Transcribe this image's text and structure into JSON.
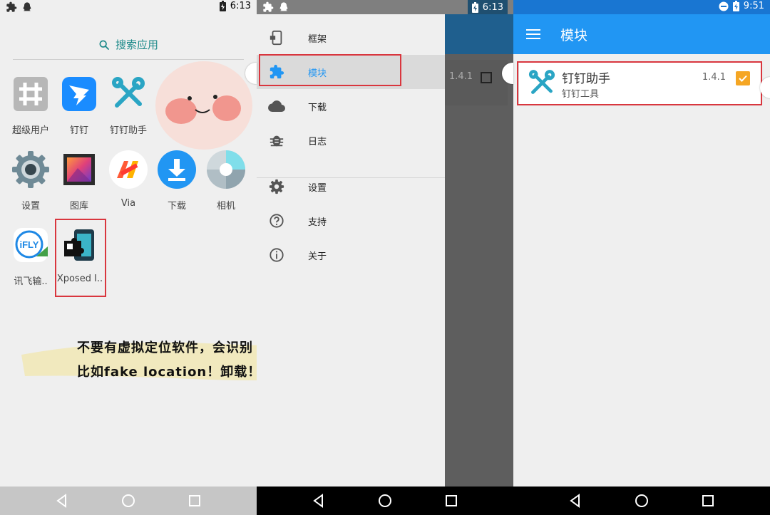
{
  "panel1": {
    "status_time": "6:13",
    "search_label": "搜索应用",
    "apps": [
      {
        "label": "超级用户",
        "icon": "superuser-icon"
      },
      {
        "label": "钉钉",
        "icon": "dingtalk-icon"
      },
      {
        "label": "钉钉助手",
        "icon": "tools-icon"
      },
      {
        "label": "设置",
        "icon": "settings-icon"
      },
      {
        "label": "图库",
        "icon": "gallery-icon"
      },
      {
        "label": "Via",
        "icon": "via-icon"
      },
      {
        "label": "下载",
        "icon": "download-icon"
      },
      {
        "label": "相机",
        "icon": "camera-icon"
      },
      {
        "label": "讯飞输..",
        "icon": "ifly-icon"
      },
      {
        "label": "Xposed I..",
        "icon": "xposed-icon"
      }
    ],
    "note_line1": "不要有虚拟定位软件，会识别",
    "note_line2": "比如fake location！卸载！！！",
    "ifly_icon_text": "iFLY"
  },
  "panel2": {
    "status_time": "6:13",
    "peek_version": "1.4.1",
    "menu": [
      {
        "label": "框架",
        "icon": "framework-icon"
      },
      {
        "label": "模块",
        "icon": "puzzle-icon"
      },
      {
        "label": "下载",
        "icon": "cloud-icon"
      },
      {
        "label": "日志",
        "icon": "bug-icon"
      },
      {
        "label": "设置",
        "icon": "gear-icon"
      },
      {
        "label": "支持",
        "icon": "help-icon"
      },
      {
        "label": "关于",
        "icon": "info-icon"
      }
    ]
  },
  "panel3": {
    "status_time": "9:51",
    "title": "模块",
    "module": {
      "name": "钉钉助手",
      "description": "钉钉工具",
      "version": "1.4.1",
      "enabled": true
    }
  },
  "colors": {
    "accent": "#2196f3",
    "teal": "#1e8a8a",
    "highlight_box": "#d9363e",
    "checkbox": "#f5a623"
  }
}
